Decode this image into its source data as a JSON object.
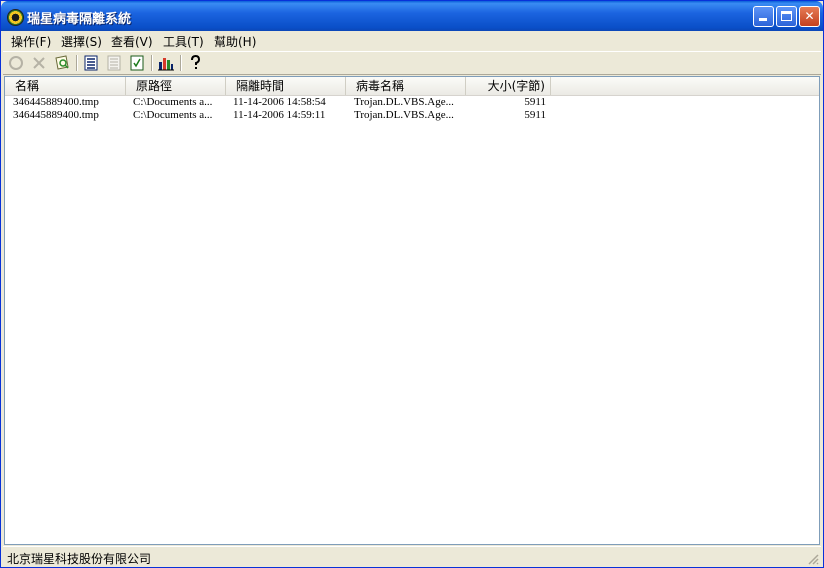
{
  "window": {
    "title": "瑞星病毒隔離系統",
    "controls": {
      "minimize": "minimize",
      "maximize": "maximize",
      "close": "close"
    }
  },
  "menu": {
    "items": [
      {
        "label": "操作(F)"
      },
      {
        "label": "選擇(S)"
      },
      {
        "label": "查看(V)"
      },
      {
        "label": "工具(T)"
      },
      {
        "label": "幫助(H)"
      }
    ]
  },
  "toolbar": {
    "buttons": [
      {
        "icon": "restore-circle-icon",
        "enabled": false
      },
      {
        "icon": "delete-x-icon",
        "enabled": false
      },
      {
        "icon": "scan-file-icon",
        "enabled": true
      },
      {
        "icon": "detail-list-icon",
        "enabled": true
      },
      {
        "icon": "grid-list-icon",
        "enabled": false
      },
      {
        "icon": "doc-check-icon",
        "enabled": true
      },
      {
        "icon": "bar-chart-icon",
        "enabled": true
      },
      {
        "icon": "help-icon",
        "enabled": true
      }
    ]
  },
  "table": {
    "columns": [
      "名稱",
      "原路徑",
      "隔離時間",
      "病毒名稱",
      "大小(字節)"
    ],
    "rows": [
      [
        "346445889400.tmp",
        "C:\\Documents a...",
        "11-14-2006 14:58:54",
        "Trojan.DL.VBS.Age...",
        "5911"
      ],
      [
        "346445889400.tmp",
        "C:\\Documents a...",
        "11-14-2006 14:59:11",
        "Trojan.DL.VBS.Age...",
        "5911"
      ]
    ]
  },
  "status": {
    "text": "北京瑞星科技股份有限公司"
  },
  "colors": {
    "titlebar": "#0a4fc8",
    "window_face": "#ece9d8",
    "list_background": "#ffffff"
  }
}
